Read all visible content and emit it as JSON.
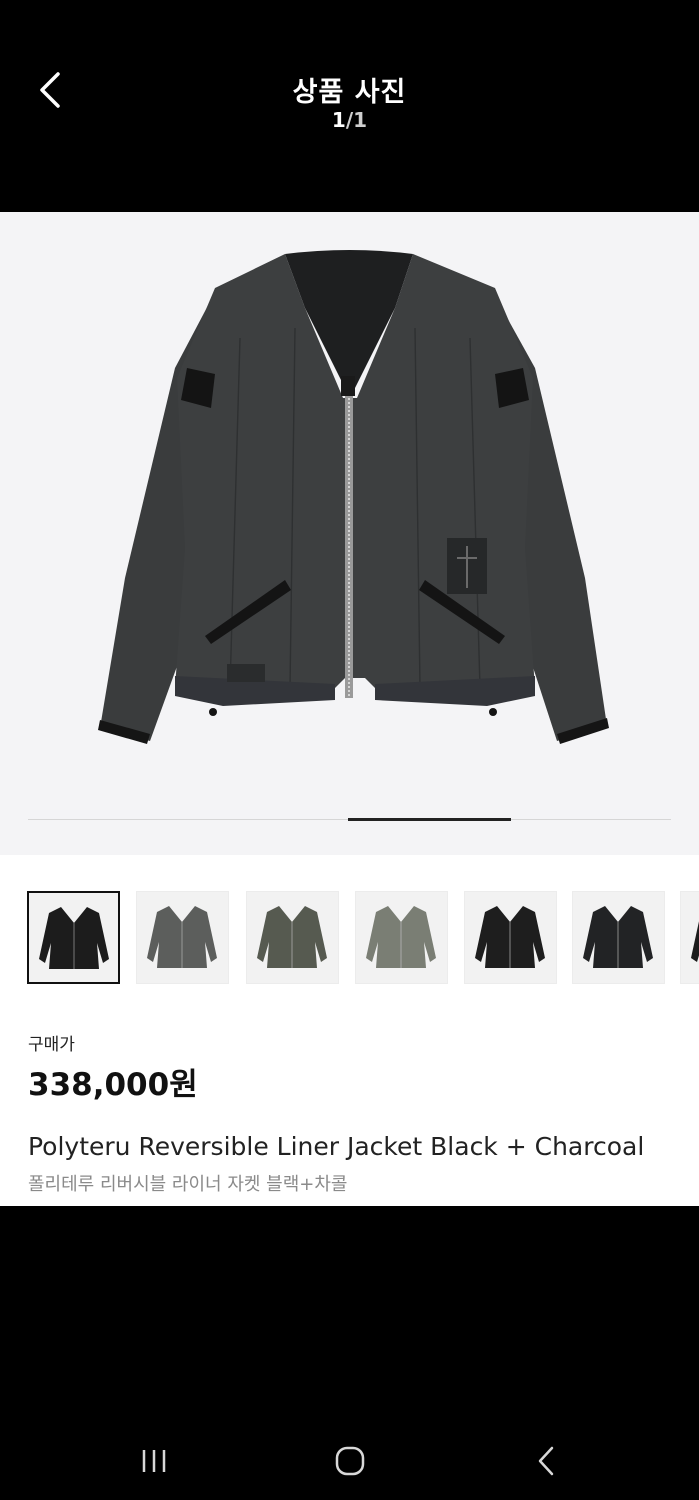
{
  "header": {
    "title": "상품 사진",
    "counter_current": "1",
    "counter_separator": "/",
    "counter_total": "1"
  },
  "icons": {
    "back": "chevron-left-icon",
    "nav_recent": "recent-apps-icon",
    "nav_home": "home-icon",
    "nav_back": "nav-back-icon"
  },
  "gallery": {
    "progress": 0.25,
    "thumbnail_count": 7,
    "selected_index": 0
  },
  "product": {
    "price_label": "구매가",
    "price": "338,000원",
    "name_en": "Polyteru Reversible Liner Jacket Black + Charcoal",
    "name_ko": "폴리테루 리버시블 라이너 자켓 블랙+차콜"
  },
  "colors": {
    "background": "#000000",
    "photo_bg": "#f4f4f6",
    "jacket": "#3c3e3f"
  }
}
